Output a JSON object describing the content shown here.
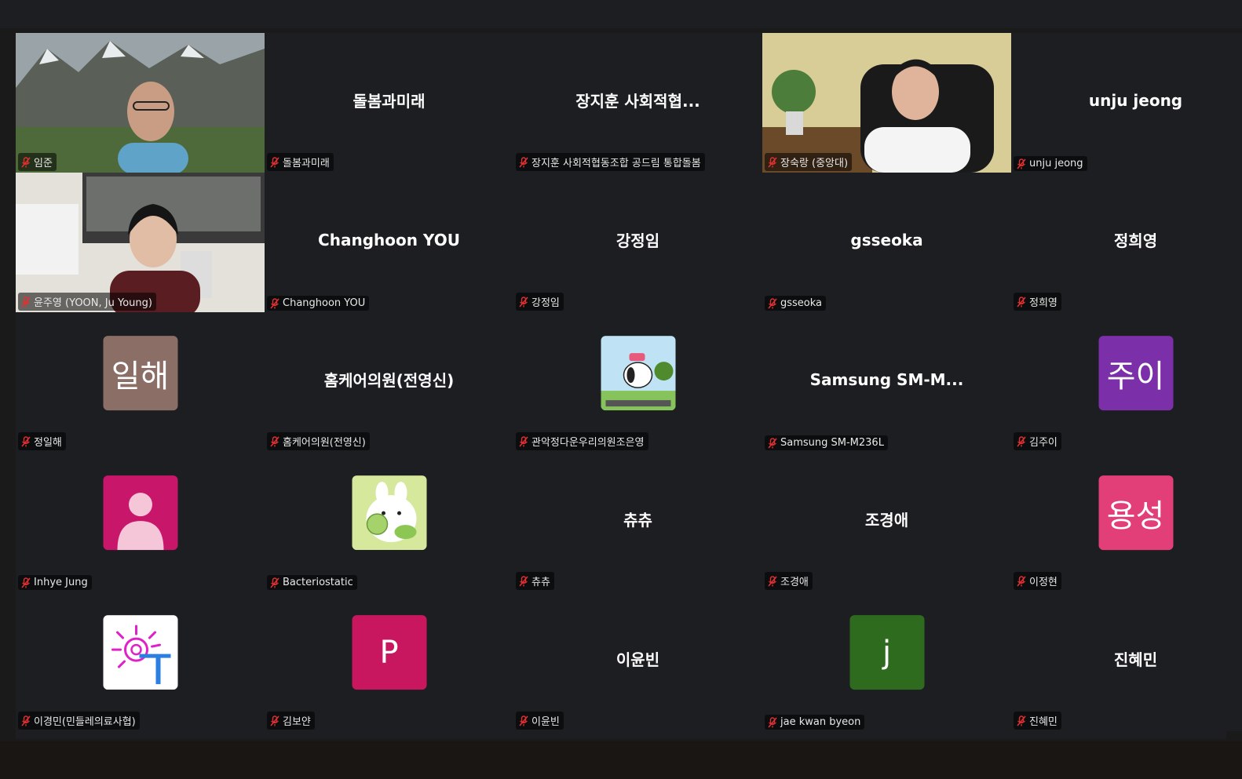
{
  "participants": [
    {
      "label": "임준",
      "big": "",
      "kind": "video",
      "scene": "mountain"
    },
    {
      "label": "돌봄과미래",
      "big": "돌봄과미래",
      "kind": "name"
    },
    {
      "label": "장지훈 사회적협동조합 공드림 통합돌봄",
      "big": "장지훈 사회적협...",
      "kind": "name"
    },
    {
      "label": "장숙랑 (중앙대)",
      "big": "",
      "kind": "video",
      "scene": "office",
      "active": true
    },
    {
      "label": "unju jeong",
      "big": "unju jeong",
      "kind": "name"
    },
    {
      "label": "윤주영 (YOON, Ju Young)",
      "big": "",
      "kind": "video",
      "scene": "room"
    },
    {
      "label": "Changhoon YOU",
      "big": "Changhoon YOU",
      "kind": "name"
    },
    {
      "label": "강정임",
      "big": "강정임",
      "kind": "name"
    },
    {
      "label": "gsseoka",
      "big": "gsseoka",
      "kind": "name"
    },
    {
      "label": "정희영",
      "big": "정희영",
      "kind": "name"
    },
    {
      "label": "정일해",
      "big": "일해",
      "kind": "avatar",
      "color": "#8b6f66"
    },
    {
      "label": "홈케어의원(전영신)",
      "big": "홈케어의원(전영신)",
      "kind": "name"
    },
    {
      "label": "관악정다운우리의원조은영",
      "big": "",
      "kind": "picture",
      "pic": "snoopy"
    },
    {
      "label": "Samsung SM-M236L",
      "big": "Samsung  SM-M...",
      "kind": "name"
    },
    {
      "label": "김주이",
      "big": "주이",
      "kind": "avatar",
      "color": "#7b2fa8"
    },
    {
      "label": "Inhye Jung",
      "big": "",
      "kind": "person",
      "color": "#c8176b"
    },
    {
      "label": "Bacteriostatic",
      "big": "",
      "kind": "picture",
      "pic": "molang"
    },
    {
      "label": "츄츄",
      "big": "츄츄",
      "kind": "name"
    },
    {
      "label": "조경애",
      "big": "조경애",
      "kind": "name"
    },
    {
      "label": "이정현",
      "big": "용성",
      "kind": "avatar",
      "color": "#e23e78"
    },
    {
      "label": "이경민(민들레의료사협)",
      "big": "",
      "kind": "picture",
      "pic": "sun"
    },
    {
      "label": "김보얀",
      "big": "P",
      "kind": "avatar",
      "color": "#c8175e"
    },
    {
      "label": "이윤빈",
      "big": "이윤빈",
      "kind": "name"
    },
    {
      "label": "jae kwan byeon",
      "big": "j",
      "kind": "avatar",
      "color": "#2f6b1f"
    },
    {
      "label": "진혜민",
      "big": "진혜민",
      "kind": "name"
    }
  ],
  "colors": {
    "active_border": "#2ed573",
    "tile_bg": "#1c1e22",
    "mute": "#e03030"
  }
}
